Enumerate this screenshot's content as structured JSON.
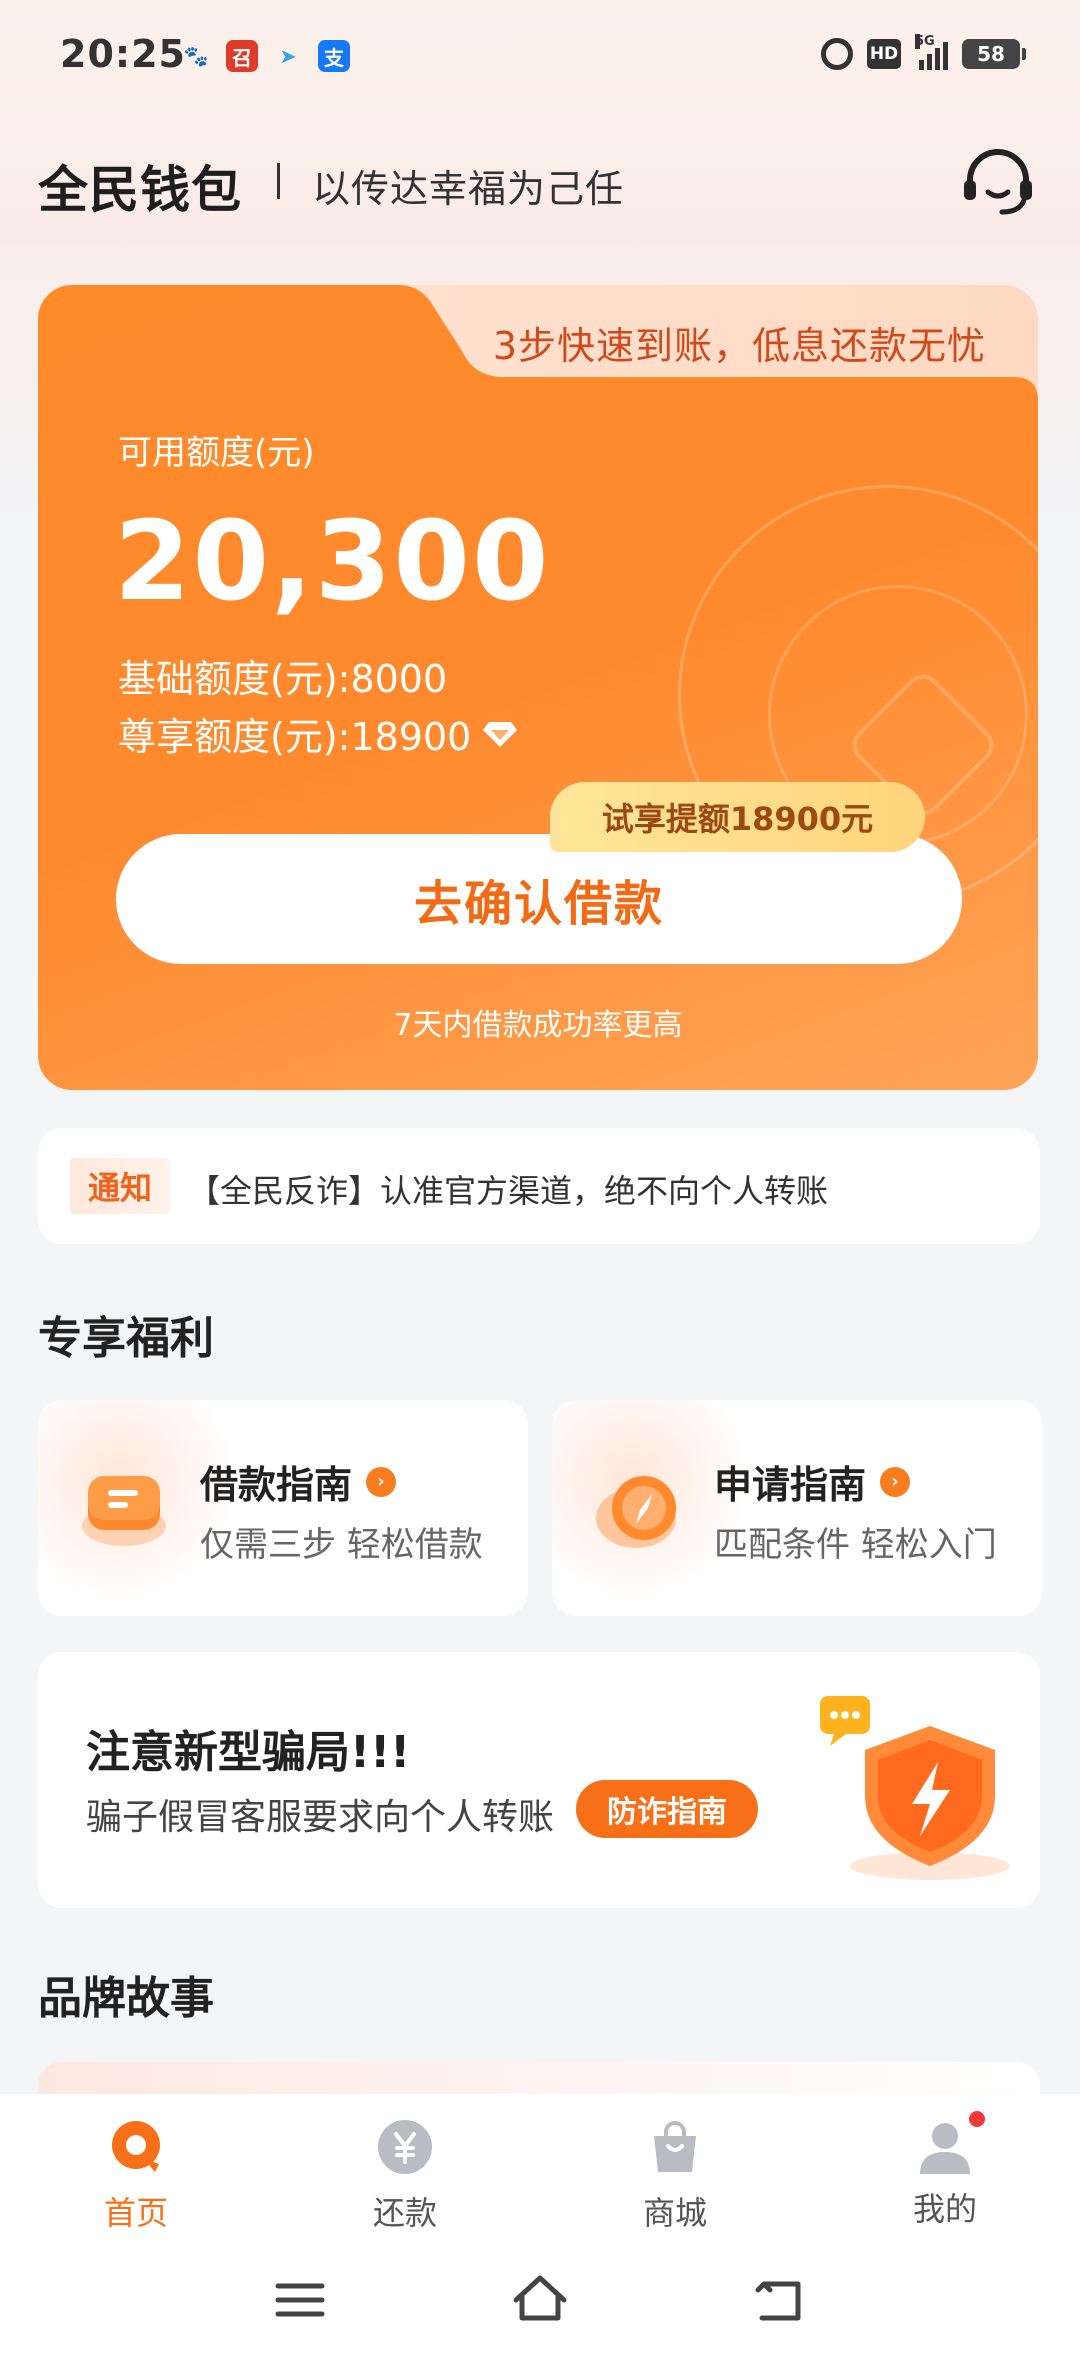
{
  "status_bar": {
    "time": "20:25",
    "apps": [
      {
        "icon": "baidu-icon",
        "glyph": "🐾",
        "color": "#2b63e6"
      },
      {
        "icon": "app-red-icon",
        "glyph": "召",
        "color": "#e03a2a"
      },
      {
        "icon": "telegram-icon",
        "glyph": "➤",
        "color": "#2fa3e6"
      },
      {
        "icon": "alipay-icon",
        "glyph": "支",
        "color": "#1677ff"
      }
    ],
    "hd": "HD",
    "network": "5G",
    "battery": "58"
  },
  "header": {
    "brand": "全民钱包",
    "slogan": "以传达幸福为己任"
  },
  "credit_card": {
    "tab_text": "3步快速到账，低息还款无忧",
    "available_label": "可用额度(元)",
    "available_value": "20,300",
    "base_quota": "基础额度(元):8000",
    "premium_quota": "尊享额度(元):18900",
    "trial_badge": "试享提额18900元",
    "confirm_button": "去确认借款",
    "note": "7天内借款成功率更高"
  },
  "notice": {
    "tag": "通知",
    "text": "【全民反诈】认准官方渠道，绝不向个人转账"
  },
  "benefits": {
    "title": "专享福利",
    "items": [
      {
        "title": "借款指南",
        "subtitle": "仅需三步 轻松借款"
      },
      {
        "title": "申请指南",
        "subtitle": "匹配条件 轻松入门"
      }
    ]
  },
  "scam_alert": {
    "title": "注意新型骗局!!!",
    "subtitle": "骗子假冒客服要求向个人转账",
    "button": "防诈指南"
  },
  "brand_story": {
    "title": "品牌故事"
  },
  "tabbar": {
    "items": [
      {
        "label": "首页",
        "active": true
      },
      {
        "label": "还款",
        "active": false
      },
      {
        "label": "商城",
        "active": false
      },
      {
        "label": "我的",
        "active": false
      }
    ]
  },
  "colors": {
    "accent": "#f77018",
    "card_orange": "#ff8a2a",
    "badge_yellow": "#ffe59a"
  }
}
